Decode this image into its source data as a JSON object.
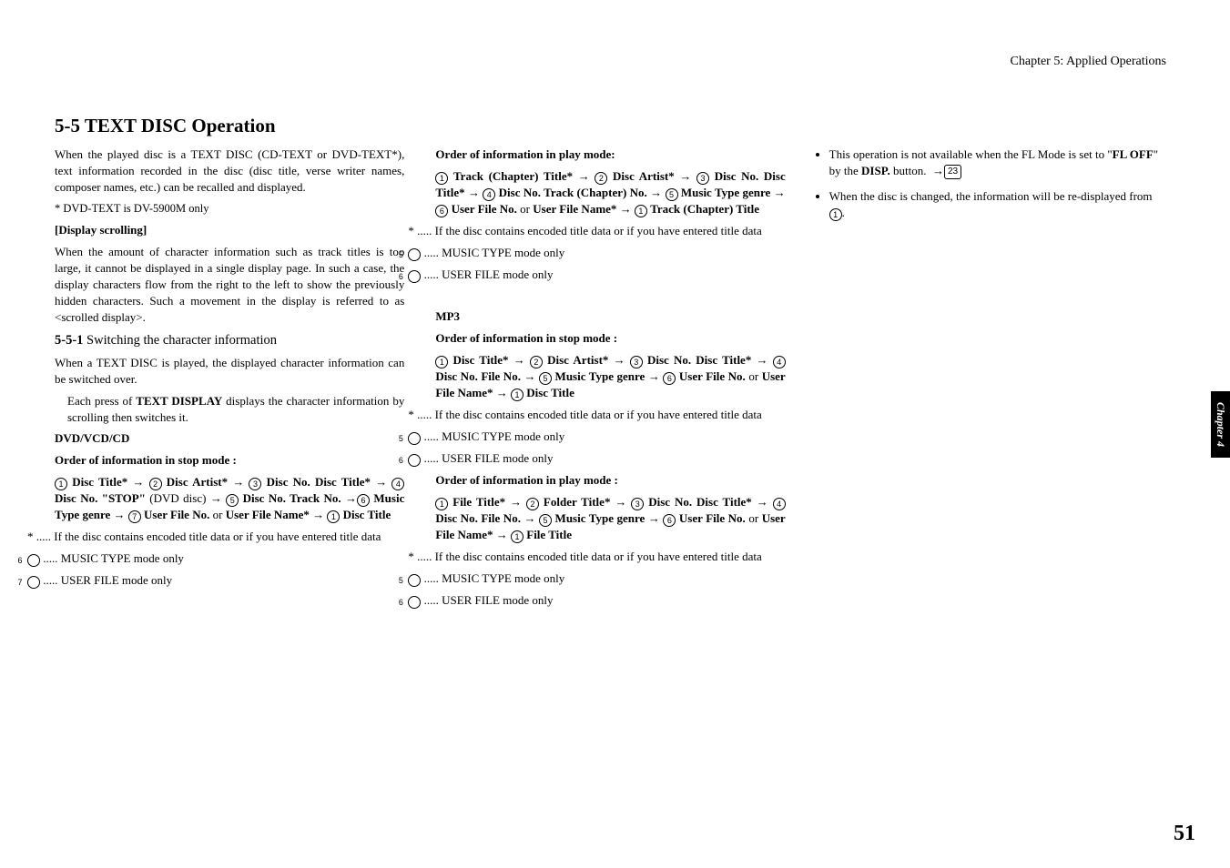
{
  "hdr": "Chapter 5: Applied Operations",
  "sect": "5-5  TEXT DISC Operation",
  "p1": "When the played disc is a TEXT DISC (CD-TEXT or DVD-TEXT*), text information recorded in the disc (disc title, verse writer names, composer names, etc.) can be recalled and displayed.",
  "p2": "* DVD-TEXT is DV-5900M only",
  "dsh": "[Display scrolling]",
  "p3": "When the amount of character information such as track titles is too large, it cannot be displayed in a single display page. In such a case, the display characters flow from the right to the left to show the previously hidden characters. Such a movement in the display is referred to as <scrolled display>.",
  "sub1no": "5-5-1",
  "sub1txt": " Switching the character information",
  "p4": "When a TEXT DISC is played, the displayed character information can be switched over.",
  "p5a": "Each press of ",
  "p5b": "TEXT DISPLAY",
  "p5c": " displays the character information by scrolling then switches it.",
  "dvdhd": "DVD/VCD/CD",
  "ord_stop": "Order of information in stop mode :",
  "seq1": {
    "a": "Disc Title*",
    "b": "Disc Artist*",
    "c": "Disc No. Disc Title*",
    "d": "Disc No. \"STOP\"",
    "dp": " (DVD disc) ",
    "e": "Disc No.  Track No.",
    "f": "Music Type genre",
    "g": "User File No.",
    "h": "User File Name*",
    "i": "Disc Title"
  },
  "note_star": "* ..... If the disc contains encoded title data or if you have entered title data",
  "note6": " ..... MUSIC TYPE mode only",
  "note7": " ..... USER FILE mode only",
  "ord_play": "Order of information in play mode:",
  "seq2": {
    "a": "Track (Chapter) Title*",
    "b": "Disc Artist*",
    "c": "Disc No. Disc Title*",
    "d": "Disc No. Track (Chapter) No.",
    "e": "Music Type genre",
    "f": "User File No.",
    "g": "User File Name*",
    "h": "Track (Chapter) Title"
  },
  "mp3": "MP3",
  "ord_stop2": "Order of information in stop mode :",
  "seq3": {
    "a": "Disc Title*",
    "b": "Disc Artist*",
    "c": "Disc No. Disc Title*",
    "d": "Disc No.  File No.",
    "e": "Music Type genre",
    "f": "User File No.",
    "g": "User File Name*",
    "h": "Disc Title"
  },
  "ord_play2": "Order of information in play mode :",
  "seq4": {
    "a": "File Title*",
    "b": "Folder Title*",
    "c": "Disc No. Disc Title*",
    "d": "Disc No. File No.",
    "e": "Music Type genre",
    "f": "User File No.",
    "g": "User File Name*",
    "h": "File Title"
  },
  "c3_1a": "This operation is not available when the FL Mode is set to \"",
  "c3_1b": "FL OFF",
  "c3_1c": "\" by the ",
  "c3_1d": "DISP.",
  "c3_1e": " button.",
  "pgref": "23",
  "c3_2a": "When the disc is changed, the information will be re-displayed from ",
  "c3_2b": ".",
  "sidetab": "Chapter 4",
  "pnum": "51",
  "or": " or "
}
